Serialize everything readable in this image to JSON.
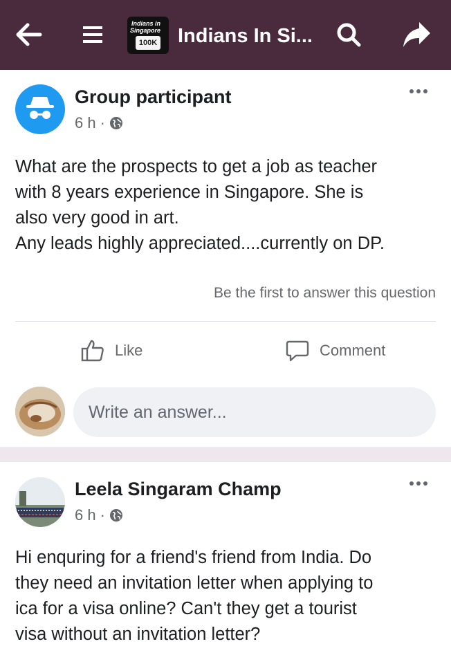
{
  "header": {
    "group_title": "Indians In Si...",
    "group_thumb_line1": "Indians in",
    "group_thumb_line2": "Singapore",
    "group_thumb_badge": "100K",
    "icons": [
      "back-arrow-icon",
      "hamburger-menu-icon",
      "search-icon",
      "share-icon"
    ],
    "background_color": "#4a2b3d"
  },
  "posts": [
    {
      "author": "Group participant",
      "time": "6 h",
      "separator": "·",
      "visibility_icon": "globe-icon",
      "body_lines": [
        "What are the prospects to get a job as teacher",
        "with 8 years experience in Singapore. She is",
        "also very good in art.",
        "Any leads highly appreciated....currently on DP."
      ],
      "first_answer_prompt": "Be the first to answer this question",
      "like_label": "Like",
      "comment_label": "Comment",
      "answer_placeholder": "Write an answer..."
    },
    {
      "author": "Leela Singaram Champ",
      "time": "6 h",
      "separator": "·",
      "visibility_icon": "globe-icon",
      "body_lines": [
        "Hi enquring for a friend's friend from India. Do",
        "they need an invitation letter when applying to",
        "ica for a visa online? Can't they get a tourist",
        "visa without an invitation letter?"
      ]
    }
  ],
  "colors": {
    "accent_blue": "#1e9bf0",
    "secondary_text": "#65676b"
  }
}
